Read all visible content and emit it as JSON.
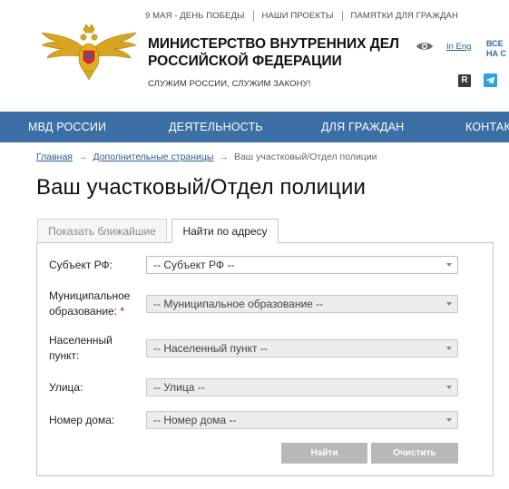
{
  "topbar": {
    "links": [
      "9 МАЯ - ДЕНЬ ПОБЕДЫ",
      "НАШИ ПРОЕКТЫ",
      "ПАМЯТКИ ДЛЯ ГРАЖДАН"
    ]
  },
  "header": {
    "ministry_line1": "МИНИСТЕРСТВО ВНУТРЕННИХ ДЕЛ",
    "ministry_line2": "РОССИЙСКОЙ ФЕДЕРАЦИИ",
    "slogan": "СЛУЖИМ РОССИИ, СЛУЖИМ ЗАКОНУ!",
    "lang_link": "In Eng",
    "cut_line1": "ВСЕ",
    "cut_line2": "НА С",
    "rss_letter": "R",
    "icons": {
      "emblem": "emblem-logo",
      "accessibility": "eye-icon",
      "rss": "rss-icon",
      "telegram": "telegram-icon"
    }
  },
  "nav": {
    "items": [
      "МВД РОССИИ",
      "ДЕЯТЕЛЬНОСТЬ",
      "ДЛЯ ГРАЖДАН",
      "КОНТАКТ"
    ],
    "color": "#3c6fa6"
  },
  "breadcrumb": {
    "items": [
      "Главная",
      "Дополнительные страницы",
      "Ваш участковый/Отдел полиции"
    ]
  },
  "page_title": "Ваш участковый/Отдел полиции",
  "tabs": [
    {
      "label": "Показать ближайшие",
      "active": false
    },
    {
      "label": "Найти по адресу",
      "active": true
    }
  ],
  "form": {
    "subject": {
      "label": "Субъект РФ:",
      "value": "-- Субъект РФ --"
    },
    "municipal": {
      "label_line1": "Муниципальное",
      "label_line2": "образование:",
      "required_mark": "*",
      "value": "-- Муниципальное образование --"
    },
    "locality": {
      "label_line1": "Населенный",
      "label_line2": "пункт:",
      "value": "-- Населенный пункт --"
    },
    "street": {
      "label": "Улица:",
      "value": "-- Улица --"
    },
    "house": {
      "label": "Номер дома:",
      "value": "-- Номер дома --"
    }
  },
  "buttons": {
    "find": "Найти",
    "clear": "Очистить"
  }
}
